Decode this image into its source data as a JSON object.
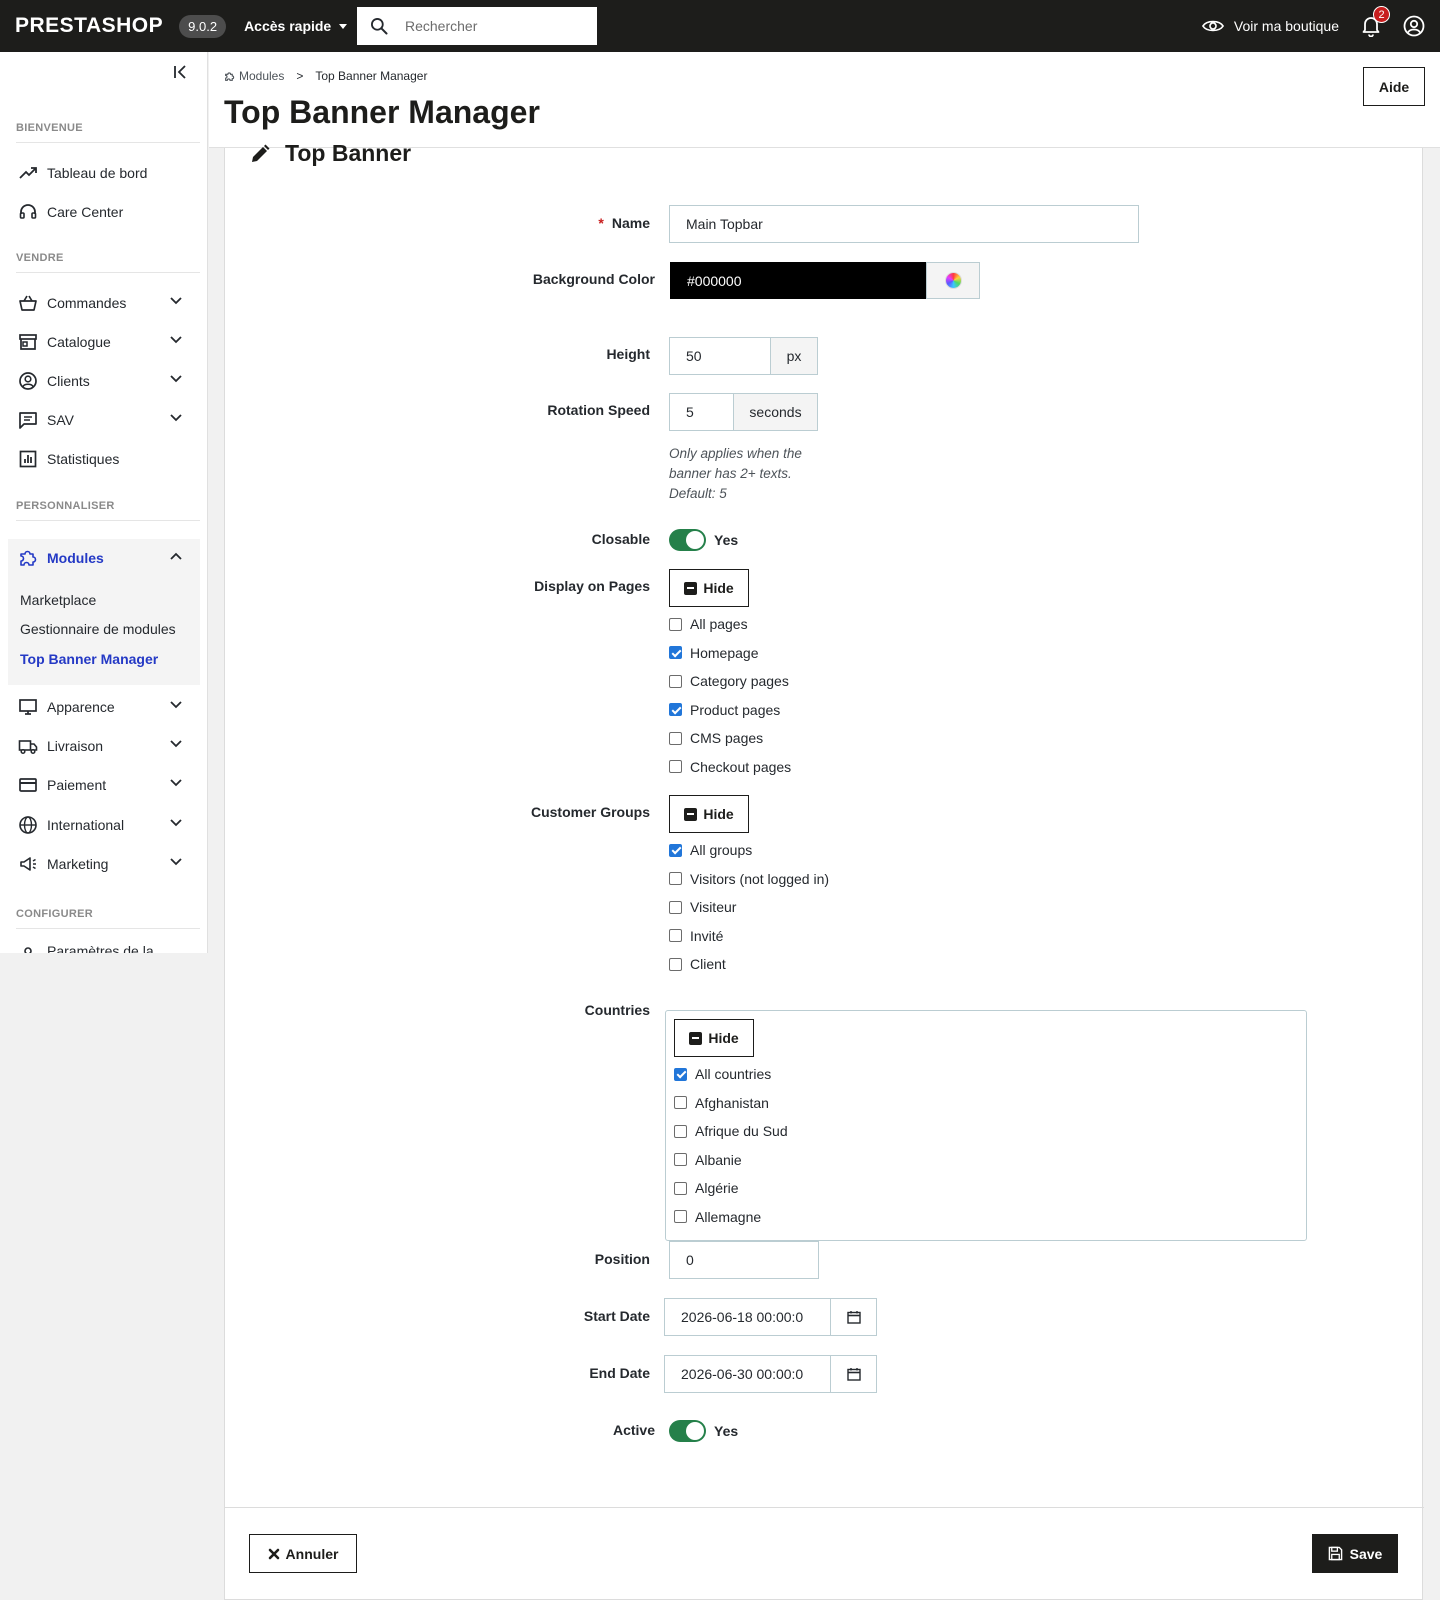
{
  "header": {
    "logo": "PRESTASHOP",
    "version": "9.0.2",
    "quick_access": "Accès rapide",
    "search_placeholder": "Rechercher",
    "view_shop": "Voir ma boutique",
    "notifications_count": "2"
  },
  "sidebar": {
    "sections": {
      "welcome": "BIENVENUE",
      "sell": "VENDRE",
      "customize": "PERSONNALISER",
      "configure": "CONFIGURER"
    },
    "items": {
      "dashboard": "Tableau de bord",
      "care_center": "Care Center",
      "orders": "Commandes",
      "catalog": "Catalogue",
      "customers": "Clients",
      "sav": "SAV",
      "stats": "Statistiques",
      "modules": "Modules",
      "appearance": "Apparence",
      "shipping": "Livraison",
      "payment": "Paiement",
      "international": "International",
      "marketing": "Marketing",
      "shop_params": "Paramètres de la"
    },
    "modules_sub": {
      "marketplace": "Marketplace",
      "module_manager": "Gestionnaire de modules",
      "top_banner": "Top Banner Manager"
    }
  },
  "page": {
    "breadcrumb": [
      "Modules",
      "Top Banner Manager"
    ],
    "title": "Top Banner Manager",
    "help_button": "Aide"
  },
  "form": {
    "card_title": "Top Banner",
    "name": {
      "label": "Name",
      "required_mark": "*",
      "value": "Main Topbar"
    },
    "background_color": {
      "label": "Background Color",
      "value": "#000000"
    },
    "height": {
      "label": "Height",
      "value": "50",
      "unit": "px"
    },
    "rotation_speed": {
      "label": "Rotation Speed",
      "value": "5",
      "unit": "seconds",
      "help": [
        "Only applies when the",
        "banner has 2+ texts.",
        "Default: 5"
      ]
    },
    "closable": {
      "label": "Closable",
      "state": "Yes",
      "on": true
    },
    "display_pages": {
      "label": "Display on Pages",
      "hide_button": "Hide",
      "options": [
        {
          "label": "All pages",
          "checked": false
        },
        {
          "label": "Homepage",
          "checked": true
        },
        {
          "label": "Category pages",
          "checked": false
        },
        {
          "label": "Product pages",
          "checked": true
        },
        {
          "label": "CMS pages",
          "checked": false
        },
        {
          "label": "Checkout pages",
          "checked": false
        }
      ]
    },
    "customer_groups": {
      "label": "Customer Groups",
      "hide_button": "Hide",
      "options": [
        {
          "label": "All groups",
          "checked": true
        },
        {
          "label": "Visitors (not logged in)",
          "checked": false
        },
        {
          "label": "Visiteur",
          "checked": false
        },
        {
          "label": "Invité",
          "checked": false
        },
        {
          "label": "Client",
          "checked": false
        }
      ]
    },
    "countries": {
      "label": "Countries",
      "hide_button": "Hide",
      "options": [
        {
          "label": "All countries",
          "checked": true
        },
        {
          "label": "Afghanistan",
          "checked": false
        },
        {
          "label": "Afrique du Sud",
          "checked": false
        },
        {
          "label": "Albanie",
          "checked": false
        },
        {
          "label": "Algérie",
          "checked": false
        },
        {
          "label": "Allemagne",
          "checked": false
        }
      ]
    },
    "position": {
      "label": "Position",
      "value": "0"
    },
    "start_date": {
      "label": "Start Date",
      "value": "2026-06-18 00:00:0"
    },
    "end_date": {
      "label": "End Date",
      "value": "2026-06-30 00:00:0"
    },
    "active": {
      "label": "Active",
      "state": "Yes",
      "on": true
    },
    "cancel_button": "Annuler",
    "save_button": "Save"
  },
  "colors": {
    "header_bg": "#1d1d1b",
    "accent_blue": "#2439c5",
    "toggle_green": "#25804a",
    "checkbox_blue": "#2176d9",
    "required_red": "#c81e1e"
  }
}
